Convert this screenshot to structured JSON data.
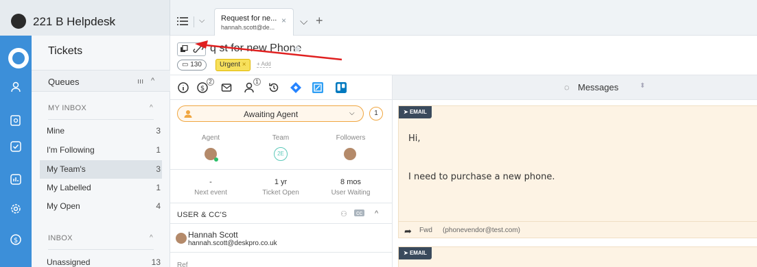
{
  "brand": {
    "name": "221 B Helpdesk",
    "caret": "⌵"
  },
  "tabs": [
    {
      "title": "Request for ne...",
      "subtitle": "hannah.scott@de...",
      "close": "×"
    }
  ],
  "tab_controls": {
    "more": "⌵",
    "add": "+"
  },
  "sidebar": {
    "title": "Tickets",
    "queues_label": "Queues",
    "queues_icon": "ııı",
    "sections": [
      {
        "label": "MY INBOX",
        "caret": "^"
      },
      {
        "label": "INBOX",
        "caret": "^"
      }
    ],
    "my_inbox": [
      {
        "label": "Mine",
        "count": "3"
      },
      {
        "label": "I'm Following",
        "count": "1"
      },
      {
        "label": "My Team's",
        "count": "3"
      },
      {
        "label": "My Labelled",
        "count": "1"
      },
      {
        "label": "My Open",
        "count": "4"
      }
    ],
    "inbox": [
      {
        "label": "Unassigned",
        "count": "13"
      }
    ]
  },
  "ticket": {
    "title": "Request for new Phone",
    "visible_title": "q  st for new Phone",
    "count": "130",
    "urgent_label": "Urgent",
    "add_label": "+ Add"
  },
  "toolbar": {
    "billing_badge": "2",
    "users_badge": "1"
  },
  "messages_bar": {
    "label": "Messages"
  },
  "properties": {
    "status": "Awaiting Agent",
    "status_badge": "1",
    "columns": [
      {
        "label": "Agent"
      },
      {
        "label": "Team",
        "value": "2E"
      },
      {
        "label": "Followers"
      }
    ],
    "stats": [
      {
        "value": "-",
        "label": "Next event"
      },
      {
        "value": "1 yr",
        "label": "Ticket Open"
      },
      {
        "value": "8 mos",
        "label": "User Waiting"
      }
    ],
    "users_section": "USER & CC'S",
    "user": {
      "name": "Hannah Scott",
      "email": "hannah.scott@deskpro.co.uk"
    },
    "ref_label": "Ref"
  },
  "messages": [
    {
      "tag": "EMAIL",
      "greeting": "Hi,",
      "body": "I need to purchase a new phone.",
      "fwd_label": "Fwd",
      "fwd_address": "(phonevendor@test.com)"
    },
    {
      "tag": "EMAIL"
    }
  ],
  "colors": {
    "rail": "#3c8fd9",
    "urgent": "#f7e05c",
    "status_border": "#f0a640",
    "message_bg": "#fdf3e4",
    "annotation_arrow": "#e02020"
  }
}
